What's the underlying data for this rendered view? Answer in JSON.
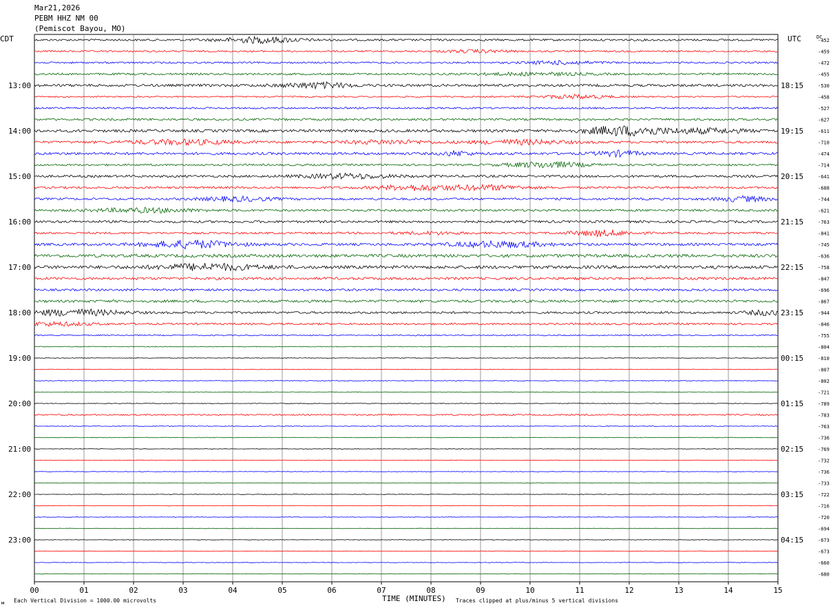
{
  "header": {
    "date": "Mar21,2026",
    "station": "PEBM HHZ NM 00",
    "location": "(Pemiscot Bayou, MO)"
  },
  "labels": {
    "left_tz": "CDT",
    "right_tz": "UTC",
    "dc_label": "DC",
    "x_axis_title": "TIME (MINUTES)",
    "scale_note": "Each Vertical Division = 1000.00 microvolts",
    "clip_note": "Traces clipped at plus/minus 5 vertical divisions",
    "corner_mark": "м"
  },
  "colors": {
    "trace_cycle": [
      "#000000",
      "#ff0000",
      "#0000ff",
      "#006400"
    ],
    "grid": "#808080",
    "text": "#000000"
  },
  "chart_data": {
    "type": "line",
    "subtype": "helicorder",
    "x_ticks": [
      "00",
      "01",
      "02",
      "03",
      "04",
      "05",
      "06",
      "07",
      "08",
      "09",
      "10",
      "11",
      "12",
      "13",
      "14",
      "15"
    ],
    "xlim": [
      0,
      15
    ],
    "left_hour_labels": [
      "13:00",
      "14:00",
      "15:00",
      "16:00",
      "17:00",
      "18:00",
      "19:00",
      "20:00",
      "21:00",
      "22:00",
      "23:00"
    ],
    "right_hour_labels": [
      "18:15",
      "19:15",
      "20:15",
      "21:15",
      "22:15",
      "23:15",
      "00:15",
      "01:15",
      "02:15",
      "03:15",
      "04:15"
    ],
    "dc_offsets": [
      -452,
      -459,
      -472,
      -455,
      -530,
      -458,
      -527,
      -627,
      -611,
      -710,
      -474,
      -714,
      -641,
      -688,
      -744,
      -621,
      -763,
      -841,
      -745,
      -636,
      -758,
      -847,
      -696,
      -867,
      -944,
      -846,
      -755,
      -804,
      -810,
      -807,
      -802,
      -721,
      -789,
      -783,
      -763,
      -736,
      -769,
      -732,
      -736,
      -733,
      -722,
      -716,
      -720,
      -694,
      -673,
      -673,
      -660,
      -680
    ],
    "trace_activity": [
      1.0,
      0.8,
      0.9,
      1.0,
      1.3,
      0.7,
      0.9,
      1.1,
      1.4,
      1.2,
      1.3,
      1.0,
      1.2,
      1.1,
      1.1,
      1.1,
      1.2,
      1.0,
      1.3,
      1.6,
      1.6,
      1.3,
      1.1,
      1.3,
      1.1,
      1.0,
      0.6,
      0.35,
      0.3,
      0.3,
      0.35,
      0.3,
      0.3,
      0.7,
      0.35,
      0.3,
      0.25,
      0.25,
      0.25,
      0.25,
      0.25,
      0.25,
      0.25,
      0.25,
      0.25,
      0.25,
      0.25,
      0.25
    ],
    "trace_count": 48
  }
}
